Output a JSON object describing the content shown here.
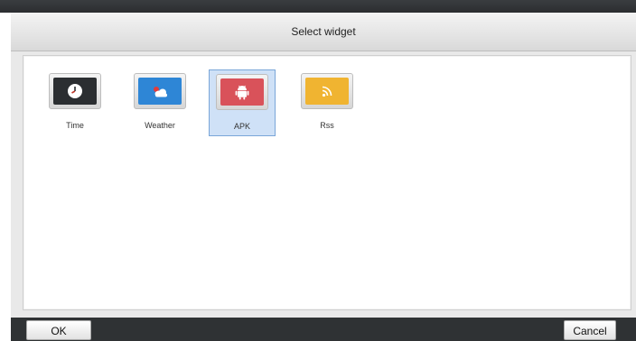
{
  "dialog": {
    "title": "Select widget",
    "selected_widget": "APK"
  },
  "widgets": [
    {
      "label": "Time",
      "icon": "clock-icon",
      "color": "#2b2e31"
    },
    {
      "label": "Weather",
      "icon": "cloud-icon",
      "color": "#2e86d6"
    },
    {
      "label": "APK",
      "icon": "android-icon",
      "color": "#d9525a"
    },
    {
      "label": "Rss",
      "icon": "rss-icon",
      "color": "#f0b431"
    }
  ],
  "footer": {
    "ok_label": "OK",
    "cancel_label": "Cancel"
  },
  "colors": {
    "selection_fill": "#cfe1f7",
    "selection_border": "#7aa6d8",
    "dialog_chrome": "#2f3234"
  }
}
